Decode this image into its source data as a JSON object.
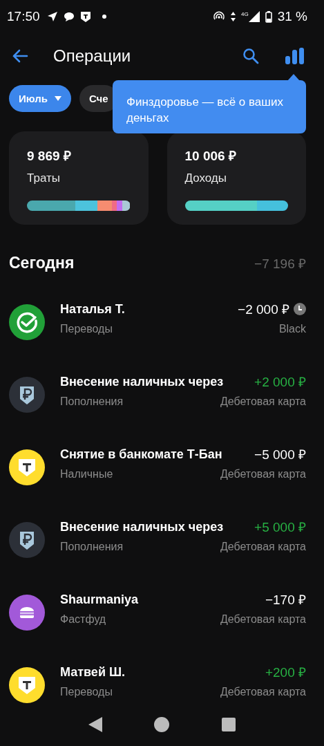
{
  "status_bar": {
    "time": "17:50",
    "battery": "31 %",
    "network": "4G"
  },
  "header": {
    "title": "Операции"
  },
  "filters": [
    {
      "label": "Июль",
      "selected": true,
      "dropdown": true
    },
    {
      "label": "Сче",
      "selected": false,
      "dropdown": false
    }
  ],
  "tooltip": {
    "text": "Финздоровье — всё о ваших деньгах"
  },
  "summary": [
    {
      "amount": "9 869 ₽",
      "label": "Траты",
      "segments": [
        {
          "color": "#4aa8ad"
        },
        {
          "color": "#4cc3dc"
        },
        {
          "color": "#f58c70"
        },
        {
          "color": "#f06b85"
        },
        {
          "color": "#c36cf0"
        },
        {
          "color": "#a9c8d6"
        }
      ]
    },
    {
      "amount": "10 006 ₽",
      "label": "Доходы",
      "segments": [
        {
          "color": "#55d0c5"
        },
        {
          "color": "#45c0dc"
        }
      ]
    }
  ],
  "section": {
    "title": "Сегодня",
    "total": "−7 196 ₽"
  },
  "operations": [
    {
      "kind": "check",
      "name": "Наталья Т.",
      "category": "Переводы",
      "amount": "−2 000 ₽",
      "income": false,
      "pending": true,
      "account": "Black"
    },
    {
      "kind": "ruble",
      "name": "Внесение наличных через",
      "category": "Пополнения",
      "amount": "+2 000 ₽",
      "income": true,
      "pending": false,
      "account": "Дебетовая карта"
    },
    {
      "kind": "shield",
      "name": "Снятие в банкомате Т-Бан",
      "category": "Наличные",
      "amount": "−5 000 ₽",
      "income": false,
      "pending": false,
      "account": "Дебетовая карта"
    },
    {
      "kind": "ruble",
      "name": "Внесение наличных через",
      "category": "Пополнения",
      "amount": "+5 000 ₽",
      "income": true,
      "pending": false,
      "account": "Дебетовая карта"
    },
    {
      "kind": "burger",
      "name": "Shaurmaniya",
      "category": "Фастфуд",
      "amount": "−170 ₽",
      "income": false,
      "pending": false,
      "account": "Дебетовая карта"
    },
    {
      "kind": "shield",
      "name": "Матвей Ш.",
      "category": "Переводы",
      "amount": "+200 ₽",
      "income": true,
      "pending": false,
      "account": "Дебетовая карта"
    }
  ]
}
